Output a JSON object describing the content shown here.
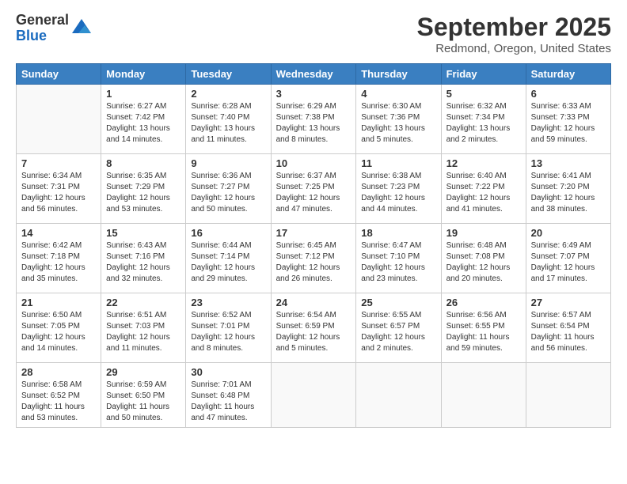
{
  "logo": {
    "general": "General",
    "blue": "Blue"
  },
  "header": {
    "month": "September 2025",
    "location": "Redmond, Oregon, United States"
  },
  "days_of_week": [
    "Sunday",
    "Monday",
    "Tuesday",
    "Wednesday",
    "Thursday",
    "Friday",
    "Saturday"
  ],
  "weeks": [
    [
      {
        "day": "",
        "info": ""
      },
      {
        "day": "1",
        "info": "Sunrise: 6:27 AM\nSunset: 7:42 PM\nDaylight: 13 hours\nand 14 minutes."
      },
      {
        "day": "2",
        "info": "Sunrise: 6:28 AM\nSunset: 7:40 PM\nDaylight: 13 hours\nand 11 minutes."
      },
      {
        "day": "3",
        "info": "Sunrise: 6:29 AM\nSunset: 7:38 PM\nDaylight: 13 hours\nand 8 minutes."
      },
      {
        "day": "4",
        "info": "Sunrise: 6:30 AM\nSunset: 7:36 PM\nDaylight: 13 hours\nand 5 minutes."
      },
      {
        "day": "5",
        "info": "Sunrise: 6:32 AM\nSunset: 7:34 PM\nDaylight: 13 hours\nand 2 minutes."
      },
      {
        "day": "6",
        "info": "Sunrise: 6:33 AM\nSunset: 7:33 PM\nDaylight: 12 hours\nand 59 minutes."
      }
    ],
    [
      {
        "day": "7",
        "info": "Sunrise: 6:34 AM\nSunset: 7:31 PM\nDaylight: 12 hours\nand 56 minutes."
      },
      {
        "day": "8",
        "info": "Sunrise: 6:35 AM\nSunset: 7:29 PM\nDaylight: 12 hours\nand 53 minutes."
      },
      {
        "day": "9",
        "info": "Sunrise: 6:36 AM\nSunset: 7:27 PM\nDaylight: 12 hours\nand 50 minutes."
      },
      {
        "day": "10",
        "info": "Sunrise: 6:37 AM\nSunset: 7:25 PM\nDaylight: 12 hours\nand 47 minutes."
      },
      {
        "day": "11",
        "info": "Sunrise: 6:38 AM\nSunset: 7:23 PM\nDaylight: 12 hours\nand 44 minutes."
      },
      {
        "day": "12",
        "info": "Sunrise: 6:40 AM\nSunset: 7:22 PM\nDaylight: 12 hours\nand 41 minutes."
      },
      {
        "day": "13",
        "info": "Sunrise: 6:41 AM\nSunset: 7:20 PM\nDaylight: 12 hours\nand 38 minutes."
      }
    ],
    [
      {
        "day": "14",
        "info": "Sunrise: 6:42 AM\nSunset: 7:18 PM\nDaylight: 12 hours\nand 35 minutes."
      },
      {
        "day": "15",
        "info": "Sunrise: 6:43 AM\nSunset: 7:16 PM\nDaylight: 12 hours\nand 32 minutes."
      },
      {
        "day": "16",
        "info": "Sunrise: 6:44 AM\nSunset: 7:14 PM\nDaylight: 12 hours\nand 29 minutes."
      },
      {
        "day": "17",
        "info": "Sunrise: 6:45 AM\nSunset: 7:12 PM\nDaylight: 12 hours\nand 26 minutes."
      },
      {
        "day": "18",
        "info": "Sunrise: 6:47 AM\nSunset: 7:10 PM\nDaylight: 12 hours\nand 23 minutes."
      },
      {
        "day": "19",
        "info": "Sunrise: 6:48 AM\nSunset: 7:08 PM\nDaylight: 12 hours\nand 20 minutes."
      },
      {
        "day": "20",
        "info": "Sunrise: 6:49 AM\nSunset: 7:07 PM\nDaylight: 12 hours\nand 17 minutes."
      }
    ],
    [
      {
        "day": "21",
        "info": "Sunrise: 6:50 AM\nSunset: 7:05 PM\nDaylight: 12 hours\nand 14 minutes."
      },
      {
        "day": "22",
        "info": "Sunrise: 6:51 AM\nSunset: 7:03 PM\nDaylight: 12 hours\nand 11 minutes."
      },
      {
        "day": "23",
        "info": "Sunrise: 6:52 AM\nSunset: 7:01 PM\nDaylight: 12 hours\nand 8 minutes."
      },
      {
        "day": "24",
        "info": "Sunrise: 6:54 AM\nSunset: 6:59 PM\nDaylight: 12 hours\nand 5 minutes."
      },
      {
        "day": "25",
        "info": "Sunrise: 6:55 AM\nSunset: 6:57 PM\nDaylight: 12 hours\nand 2 minutes."
      },
      {
        "day": "26",
        "info": "Sunrise: 6:56 AM\nSunset: 6:55 PM\nDaylight: 11 hours\nand 59 minutes."
      },
      {
        "day": "27",
        "info": "Sunrise: 6:57 AM\nSunset: 6:54 PM\nDaylight: 11 hours\nand 56 minutes."
      }
    ],
    [
      {
        "day": "28",
        "info": "Sunrise: 6:58 AM\nSunset: 6:52 PM\nDaylight: 11 hours\nand 53 minutes."
      },
      {
        "day": "29",
        "info": "Sunrise: 6:59 AM\nSunset: 6:50 PM\nDaylight: 11 hours\nand 50 minutes."
      },
      {
        "day": "30",
        "info": "Sunrise: 7:01 AM\nSunset: 6:48 PM\nDaylight: 11 hours\nand 47 minutes."
      },
      {
        "day": "",
        "info": ""
      },
      {
        "day": "",
        "info": ""
      },
      {
        "day": "",
        "info": ""
      },
      {
        "day": "",
        "info": ""
      }
    ]
  ]
}
